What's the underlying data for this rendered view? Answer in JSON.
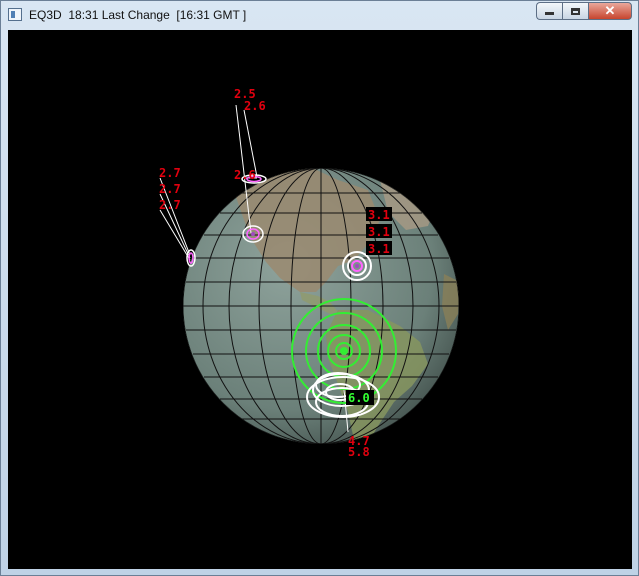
{
  "window": {
    "title": "EQ3D  18:31 Last Change  [16:31 GMT ]",
    "minimize_icon": "minimize-icon",
    "maximize_icon": "maximize-icon",
    "close_symbol": "✕"
  },
  "globe": {
    "ocean_color": "#6f8580",
    "grid_color": "#111111",
    "land_color": "#9c8c73"
  },
  "quakes": [
    {
      "label": "2.5",
      "color": "#e1000f"
    },
    {
      "label": "2.6",
      "color": "#e1000f"
    },
    {
      "label": "2.6",
      "color": "#e1000f"
    },
    {
      "label": "2.7",
      "color": "#e1000f"
    },
    {
      "label": "2.7",
      "color": "#e1000f"
    },
    {
      "label": "2.7",
      "color": "#e1000f"
    },
    {
      "label": "3.1",
      "color": "#e1000f"
    },
    {
      "label": "3.1",
      "color": "#e1000f"
    },
    {
      "label": "3.1",
      "color": "#e1000f"
    },
    {
      "label": "6.0",
      "color": "#33ff33"
    },
    {
      "label": "4.7",
      "color": "#e1000f"
    },
    {
      "label": "5.8",
      "color": "#e1000f"
    }
  ]
}
